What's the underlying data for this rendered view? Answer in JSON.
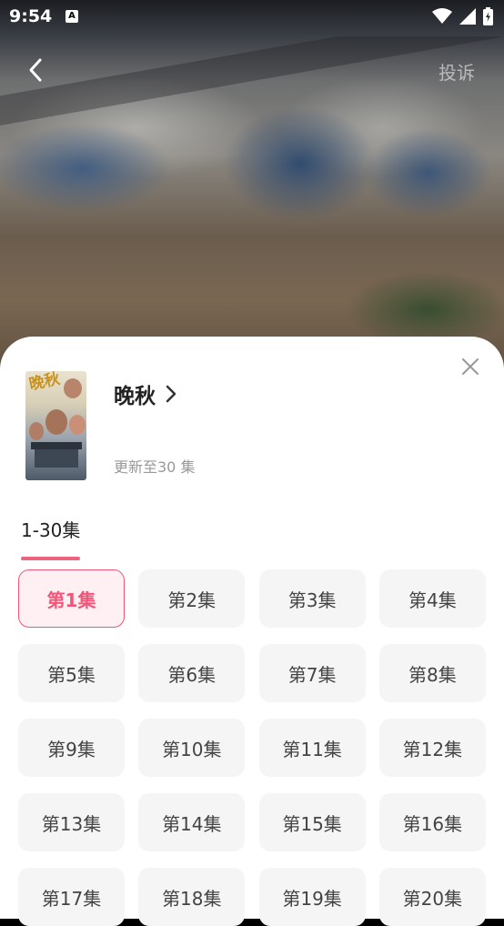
{
  "status_bar": {
    "time": "9:54",
    "app_icon_letter": "A"
  },
  "nav": {
    "report_label": "投诉"
  },
  "drama": {
    "title": "晚秋",
    "poster_text": "晚秋",
    "update_status": "更新至30 集"
  },
  "range_tab": {
    "label": "1-30集"
  },
  "colors": {
    "accent": "#f0567a",
    "underline": "#f0637f"
  },
  "episodes": [
    {
      "label": "第1集",
      "active": true
    },
    {
      "label": "第2集"
    },
    {
      "label": "第3集"
    },
    {
      "label": "第4集"
    },
    {
      "label": "第5集"
    },
    {
      "label": "第6集"
    },
    {
      "label": "第7集"
    },
    {
      "label": "第8集"
    },
    {
      "label": "第9集"
    },
    {
      "label": "第10集"
    },
    {
      "label": "第11集"
    },
    {
      "label": "第12集"
    },
    {
      "label": "第13集"
    },
    {
      "label": "第14集"
    },
    {
      "label": "第15集"
    },
    {
      "label": "第16集"
    },
    {
      "label": "第17集"
    },
    {
      "label": "第18集"
    },
    {
      "label": "第19集"
    },
    {
      "label": "第20集"
    }
  ]
}
